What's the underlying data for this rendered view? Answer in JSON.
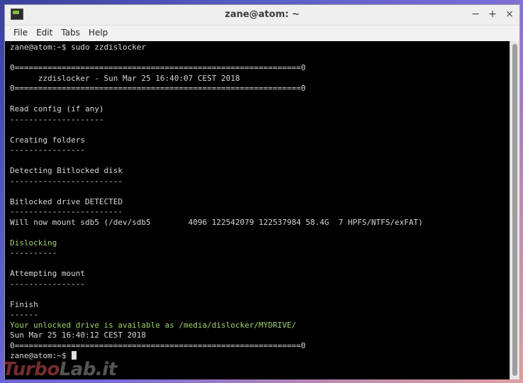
{
  "window": {
    "title": "zane@atom: ~",
    "controls": {
      "minimize": "−",
      "maximize": "+",
      "close": "×"
    }
  },
  "menubar": [
    "File",
    "Edit",
    "Tabs",
    "Help"
  ],
  "terminal": {
    "lines": [
      {
        "text": "zane@atom:~$ sudo zzdislocker",
        "color": "gray"
      },
      {
        "text": "",
        "color": "gray"
      },
      {
        "text": "0=============================================================0",
        "color": "gray"
      },
      {
        "text": "      zzdislocker - Sun Mar 25 16:40:07 CEST 2018",
        "color": "gray"
      },
      {
        "text": "0=============================================================0",
        "color": "gray"
      },
      {
        "text": "",
        "color": "gray"
      },
      {
        "text": "Read config (if any)",
        "color": "gray"
      },
      {
        "text": "--------------------",
        "color": "gray"
      },
      {
        "text": "",
        "color": "gray"
      },
      {
        "text": "Creating folders",
        "color": "gray"
      },
      {
        "text": "----------------",
        "color": "gray"
      },
      {
        "text": "",
        "color": "gray"
      },
      {
        "text": "Detecting Bitlocked disk",
        "color": "gray"
      },
      {
        "text": "------------------------",
        "color": "gray"
      },
      {
        "text": "",
        "color": "gray"
      },
      {
        "text": "Bitlocked drive DETECTED",
        "color": "gray"
      },
      {
        "text": "------------------------",
        "color": "gray"
      },
      {
        "text": "Will now mount sdb5 (/dev/sdb5        4096 122542079 122537984 58.4G  7 HPFS/NTFS/exFAT)",
        "color": "gray"
      },
      {
        "text": "",
        "color": "gray"
      },
      {
        "text": "Dislocking",
        "color": "green"
      },
      {
        "text": "----------",
        "color": "gray"
      },
      {
        "text": "",
        "color": "gray"
      },
      {
        "text": "Attempting mount",
        "color": "gray"
      },
      {
        "text": "----------------",
        "color": "gray"
      },
      {
        "text": "",
        "color": "gray"
      },
      {
        "text": "Finish",
        "color": "gray"
      },
      {
        "text": "------",
        "color": "gray"
      },
      {
        "text": "Your unlocked drive is available as /media/dislocker/MYDRIVE/",
        "color": "green"
      },
      {
        "text": "Sun Mar 25 16:40:12 CEST 2018",
        "color": "gray"
      },
      {
        "text": "0=============================================================0",
        "color": "gray"
      }
    ],
    "prompt": "zane@atom:~$ "
  },
  "watermark": {
    "part1": "Turbo",
    "part2": "Lab.it"
  },
  "colors": {
    "terminal_bg": "#000000",
    "text_gray": "#d7d7d7",
    "text_green": "#9fd46a"
  }
}
